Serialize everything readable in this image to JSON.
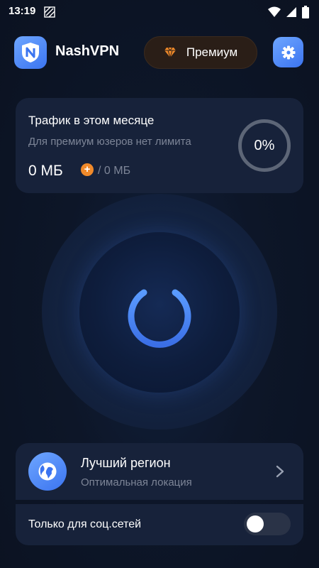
{
  "status_bar": {
    "time": "13:19"
  },
  "header": {
    "app_name": "NashVPN",
    "premium_label": "Премиум"
  },
  "traffic": {
    "title": "Трафик в этом месяце",
    "subtitle": "Для премиум юзеров нет лимита",
    "used": "0 МБ",
    "limit": "/ 0 МБ",
    "percent": "0%",
    "usage_fraction": 0
  },
  "power": {
    "state": "off"
  },
  "region": {
    "title": "Лучший регион",
    "subtitle": "Оптимальная локация"
  },
  "social_only": {
    "label": "Только для соц.сетей",
    "enabled": false
  },
  "colors": {
    "accent": "#4a86f7",
    "premium_icon": "#f08a2a",
    "background": "#0d1628",
    "card": "#17223a"
  },
  "icons": {
    "logo": "shield-n-icon",
    "premium": "diamond-icon",
    "settings": "gear-icon",
    "power": "power-icon",
    "region": "globe-icon",
    "chevron": "chevron-right-icon"
  }
}
